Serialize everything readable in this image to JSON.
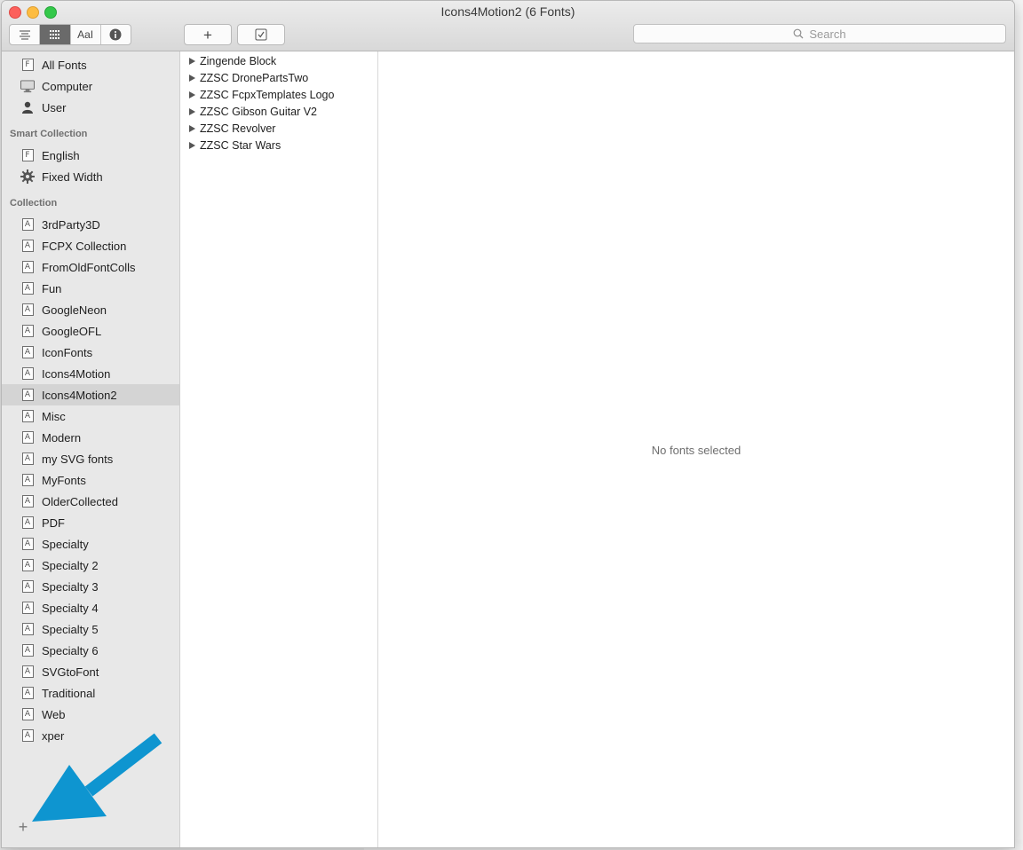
{
  "window": {
    "title": "Icons4Motion2 (6 Fonts)"
  },
  "toolbar": {
    "view_buttons": [
      {
        "icon": "list-view-icon",
        "label": ""
      },
      {
        "icon": "grid-view-icon",
        "label": ""
      },
      {
        "icon": "sample-view-icon",
        "label": "AaI"
      },
      {
        "icon": "info-icon",
        "label": ""
      }
    ],
    "add_label": "+",
    "validate_icon": "checkbox-icon",
    "search_placeholder": "Search"
  },
  "sidebar": {
    "library_items": [
      {
        "label": "All Fonts",
        "icon": "font-doc-icon"
      },
      {
        "label": "Computer",
        "icon": "computer-icon"
      },
      {
        "label": "User",
        "icon": "user-icon"
      }
    ],
    "smart_collection_header": "Smart Collection",
    "smart_items": [
      {
        "label": "English",
        "icon": "font-doc-icon"
      },
      {
        "label": "Fixed Width",
        "icon": "gear-icon"
      }
    ],
    "collection_header": "Collection",
    "collection_items": [
      {
        "label": "3rdParty3D"
      },
      {
        "label": "FCPX Collection"
      },
      {
        "label": "FromOldFontColls"
      },
      {
        "label": "Fun"
      },
      {
        "label": "GoogleNeon"
      },
      {
        "label": "GoogleOFL"
      },
      {
        "label": "IconFonts"
      },
      {
        "label": "Icons4Motion"
      },
      {
        "label": "Icons4Motion2",
        "selected": true
      },
      {
        "label": "Misc"
      },
      {
        "label": "Modern"
      },
      {
        "label": "my SVG fonts"
      },
      {
        "label": "MyFonts"
      },
      {
        "label": "OlderCollected"
      },
      {
        "label": "PDF"
      },
      {
        "label": "Specialty"
      },
      {
        "label": "Specialty 2"
      },
      {
        "label": "Specialty 3"
      },
      {
        "label": "Specialty 4"
      },
      {
        "label": "Specialty 5"
      },
      {
        "label": "Specialty 6"
      },
      {
        "label": "SVGtoFont"
      },
      {
        "label": "Traditional"
      },
      {
        "label": "Web"
      },
      {
        "label": "xper"
      }
    ],
    "add_collection_label": "+"
  },
  "font_list": [
    "Zingende Block",
    "ZZSC DronePartsTwo",
    "ZZSC FcpxTemplates Logo",
    "ZZSC Gibson Guitar V2",
    "ZZSC Revolver",
    "ZZSC Star Wars"
  ],
  "preview": {
    "empty_message": "No fonts selected"
  },
  "colors": {
    "arrow": "#0e95d0",
    "selection": "#d4d4d4",
    "close": "#fc605c",
    "minimize": "#fdbc40",
    "maximize": "#34c84a"
  }
}
